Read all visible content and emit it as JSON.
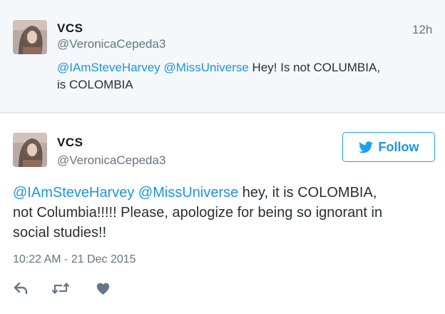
{
  "tweet_1": {
    "name": "VCS",
    "handle": "@VeronicaCepeda3",
    "time": "12h",
    "mention_1": "@IAmSteveHarvey",
    "mention_2": "@MissUniverse",
    "text_after_mentions": " Hey! Is not COLUMBIA,",
    "text_line_2": "is COLOMBIA"
  },
  "tweet_2": {
    "name": "VCS",
    "handle": "@VeronicaCepeda3",
    "follow_label": "Follow",
    "mention_1": "@IAmSteveHarvey",
    "mention_2": "@MissUniverse",
    "text_after_mentions": " hey, it is COLOMBIA,",
    "text_line_2": "not Columbia!!!!!  Please, apologize for being so ignorant in",
    "text_line_3": "social studies!!",
    "timestamp": "10:22 AM - 21 Dec 2015"
  },
  "colors": {
    "accent": "#1b95e0",
    "icon": "#657786",
    "top_background": "#f5f8fa"
  },
  "icons": [
    "twitter-bird-icon",
    "reply-icon",
    "retweet-icon",
    "like-icon"
  ]
}
